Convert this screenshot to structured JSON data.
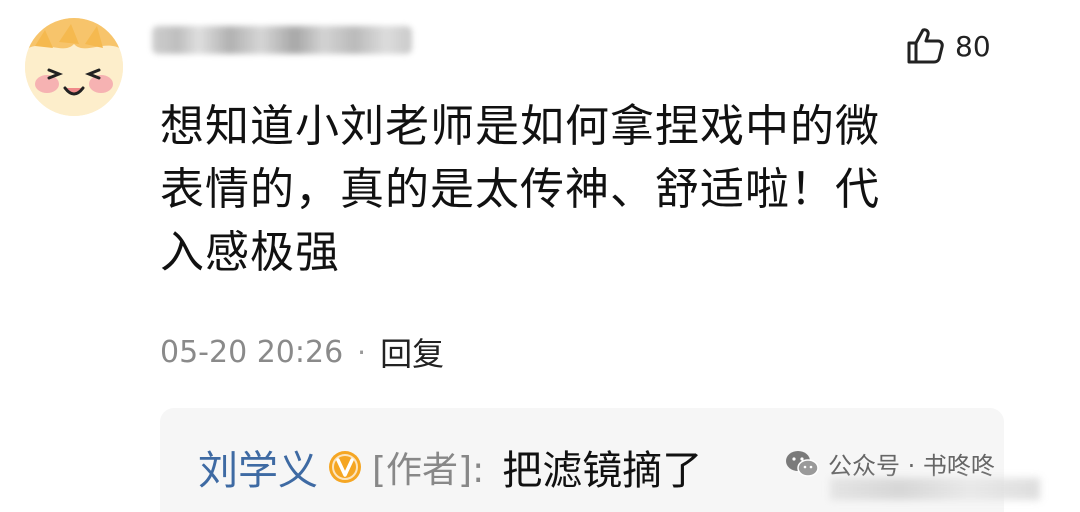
{
  "comment": {
    "like_count": "80",
    "text_lines": [
      "想知道小刘老师是如何拿捏戏中的微",
      "表情的，真的是太传神、舒适啦！代",
      "入感极强"
    ],
    "timestamp": "05-20 20:26",
    "separator": "·",
    "reply_label": "回复"
  },
  "reply": {
    "author": "刘学义",
    "author_tag": "[作者]:",
    "text": "把滤镜摘了"
  },
  "watermark": {
    "text": "公众号 · 书咚咚"
  },
  "colors": {
    "author_link": "#3e6aa3",
    "verified_badge": "#f5a623",
    "reply_background": "#f6f6f6",
    "meta_gray": "#8a8a8a"
  },
  "icons": [
    "avatar-face-icon",
    "thumbs-up-icon",
    "verified-badge-icon",
    "wechat-icon"
  ]
}
